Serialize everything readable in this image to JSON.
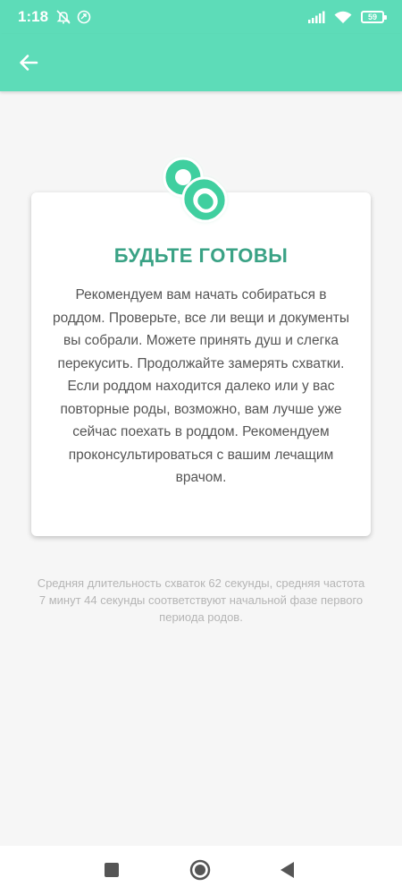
{
  "status_bar": {
    "time": "1:18",
    "battery": "59",
    "icons": [
      "mute-icon",
      "vpn-icon",
      "signal-icon",
      "wifi-icon",
      "battery-icon"
    ]
  },
  "app_bar": {
    "back_icon": "arrow-left-icon"
  },
  "card": {
    "icon": "pacifier-icon",
    "title": "БУДЬТЕ ГОТОВЫ",
    "text": "Рекомендуем вам начать собираться в роддом. Проверьте, все ли вещи и документы вы собрали. Можете принять душ и слегка перекусить. Продолжайте замерять схватки. Если роддом находится далеко или у вас повторные роды, возможно, вам лучше уже сейчас поехать в роддом. Рекомендуем проконсультироваться с вашим лечащим врачом."
  },
  "summary": "Средняя длительность схваток 62 секунды, средняя частота 7 минут 44 секунды соответствуют начальной фазе первого периода родов.",
  "colors": {
    "accent": "#5ddcb8",
    "title": "#3aa285",
    "icon_fill": "#3fcf9f"
  },
  "nav_bar": {
    "icons": [
      "recents-icon",
      "home-icon",
      "back-icon"
    ]
  }
}
